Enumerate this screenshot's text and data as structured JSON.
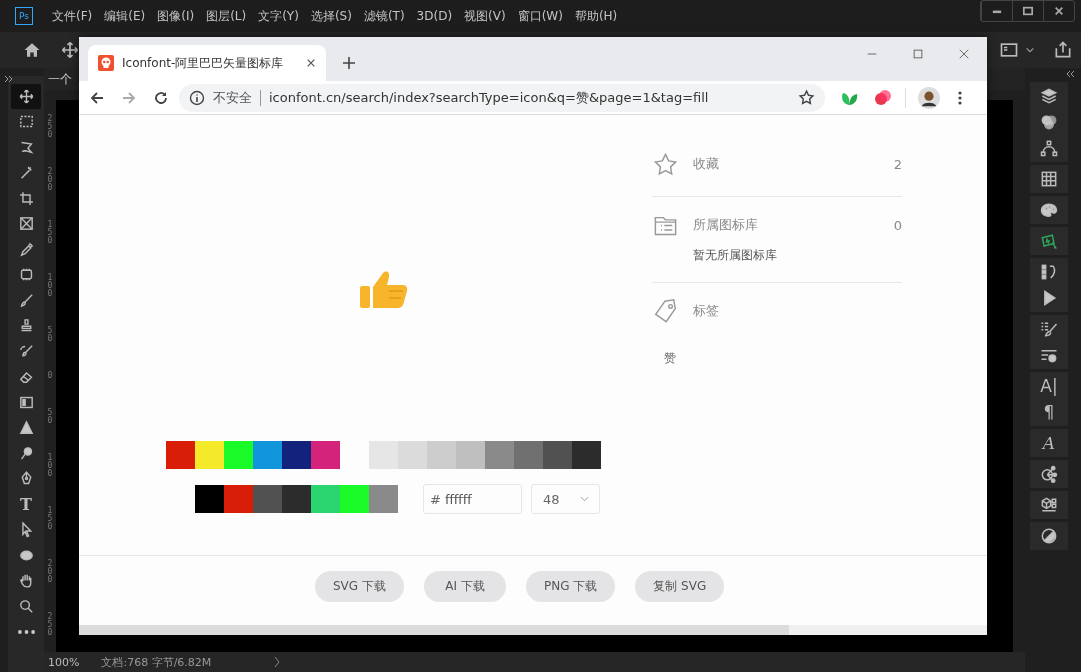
{
  "photoshop": {
    "logo": "Ps",
    "menu": [
      "文件(F)",
      "编辑(E)",
      "图像(I)",
      "图层(L)",
      "文字(Y)",
      "选择(S)",
      "滤镜(T)",
      "3D(D)",
      "视图(V)",
      "窗口(W)",
      "帮助(H)"
    ],
    "document_tab": "一个",
    "tools": [
      {
        "kind": "move",
        "selected": true
      },
      {
        "kind": "marquee",
        "selected": false
      },
      {
        "kind": "lasso",
        "selected": false
      },
      {
        "kind": "wand",
        "selected": false
      },
      {
        "kind": "crop",
        "selected": false
      },
      {
        "kind": "frame",
        "selected": false
      },
      {
        "kind": "eyedropper",
        "selected": false
      },
      {
        "kind": "patch",
        "selected": false
      },
      {
        "kind": "brush",
        "selected": false
      },
      {
        "kind": "stamp",
        "selected": false
      },
      {
        "kind": "history-brush",
        "selected": false
      },
      {
        "kind": "eraser",
        "selected": false
      },
      {
        "kind": "gradient",
        "selected": false
      },
      {
        "kind": "blur",
        "selected": false
      },
      {
        "kind": "dodge",
        "selected": false
      },
      {
        "kind": "pen",
        "selected": false
      },
      {
        "kind": "type",
        "glyph": "T",
        "selected": false
      },
      {
        "kind": "path-select",
        "selected": false
      },
      {
        "kind": "ellipse",
        "selected": false
      },
      {
        "kind": "hand",
        "selected": false
      },
      {
        "kind": "zoom",
        "selected": false
      },
      {
        "kind": "more",
        "selected": false
      }
    ],
    "ruler": [
      "250",
      "200",
      "150",
      "100",
      "50",
      "0",
      "50",
      "100",
      "150",
      "200",
      "250"
    ],
    "panels": [
      [
        {
          "kind": "layers"
        },
        {
          "kind": "channels"
        },
        {
          "kind": "paths"
        }
      ],
      [
        {
          "kind": "swatches"
        }
      ],
      [
        {
          "kind": "palette"
        }
      ],
      [
        {
          "kind": "cursor-card"
        }
      ],
      [
        {
          "kind": "history"
        },
        {
          "kind": "play"
        }
      ],
      [
        {
          "kind": "brush-presets"
        },
        {
          "kind": "adjust"
        }
      ],
      [
        {
          "kind": "glyph",
          "glyph": "A|"
        },
        {
          "kind": "glyph",
          "glyph": "¶"
        }
      ],
      [
        {
          "kind": "script",
          "glyph": "A"
        }
      ],
      [
        {
          "kind": "network"
        }
      ],
      [
        {
          "kind": "cube"
        }
      ],
      [
        {
          "kind": "contrast"
        }
      ]
    ],
    "status": {
      "zoom": "100%",
      "document": "文档:768 字节/6.82M"
    }
  },
  "browser": {
    "tab": {
      "title": "Iconfont-阿里巴巴矢量图标库"
    },
    "security": "不安全",
    "url": "iconfont.cn/search/index?searchType=icon&q=赞&page=1&tag=fill",
    "details": [
      {
        "kind": "star",
        "label": "收藏",
        "count": "2"
      },
      {
        "kind": "folder",
        "label": "所属图标库",
        "count": "0",
        "note": "暂无所属图标库"
      },
      {
        "kind": "tag",
        "label": "标签",
        "tags": [
          "赞"
        ]
      }
    ],
    "palette_bright": [
      {
        "color": "#d81e06"
      },
      {
        "color": "#f4ea2a"
      },
      {
        "color": "#1afa29"
      },
      {
        "color": "#1296db"
      },
      {
        "color": "#13227a"
      },
      {
        "color": "#d4237a"
      }
    ],
    "palette_grey": [
      {
        "color": "#e6e6e6"
      },
      {
        "color": "#dbdbdb"
      },
      {
        "color": "#cdcdcd"
      },
      {
        "color": "#bfbfbf"
      },
      {
        "color": "#8a8a8a"
      },
      {
        "color": "#707070"
      },
      {
        "color": "#515151"
      },
      {
        "color": "#2c2c2c"
      }
    ],
    "palette_recent": [
      {
        "color": "#000000"
      },
      {
        "color": "#d81e06"
      },
      {
        "color": "#515151"
      },
      {
        "color": "#2c2c2c"
      },
      {
        "color": "#2ad46f"
      },
      {
        "color": "#1afa29"
      },
      {
        "color": "#8a8a8a"
      }
    ],
    "color_field": {
      "prefix": "#",
      "value": "ffffff"
    },
    "size_select": {
      "value": "48"
    },
    "buttons": [
      "SVG 下载",
      "AI 下载",
      "PNG 下载",
      "复制 SVG"
    ]
  }
}
